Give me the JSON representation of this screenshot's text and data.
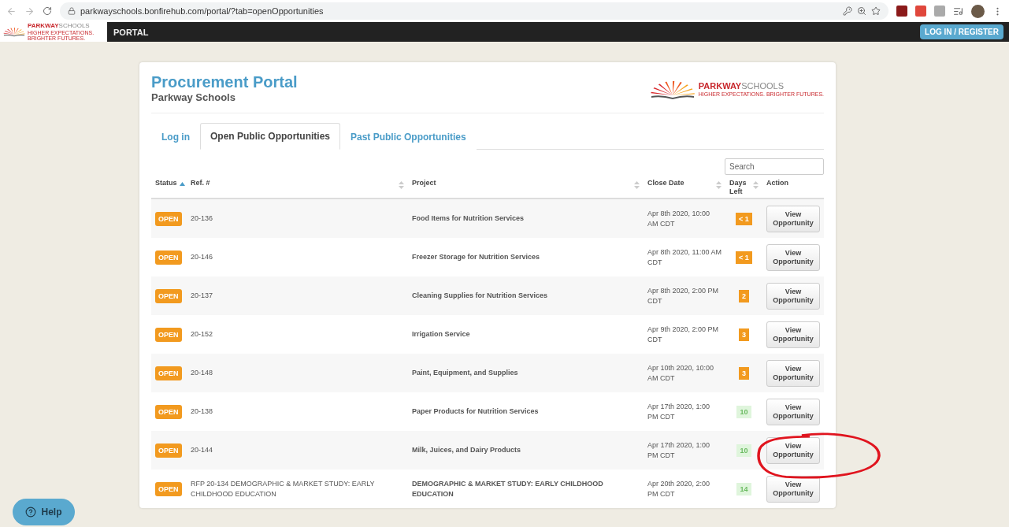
{
  "browser": {
    "url": "parkwayschools.bonfirehub.com/portal/?tab=openOpportunities"
  },
  "navbar": {
    "logo": {
      "brand_bold": "PARKWAY",
      "brand_light": "SCHOOLS",
      "tagline": "HIGHER EXPECTATIONS. BRIGHTER FUTURES."
    },
    "title": "PORTAL",
    "login_button": "LOG IN / REGISTER"
  },
  "header": {
    "title": "Procurement Portal",
    "subtitle": "Parkway Schools",
    "logo": {
      "brand_bold": "PARKWAY",
      "brand_light": "SCHOOLS",
      "tagline": "HIGHER EXPECTATIONS. BRIGHTER FUTURES."
    }
  },
  "tabs": [
    {
      "label": "Log in",
      "selected": false
    },
    {
      "label": "Open Public Opportunities",
      "selected": true
    },
    {
      "label": "Past Public Opportunities",
      "selected": false
    }
  ],
  "search": {
    "placeholder": "Search"
  },
  "table": {
    "columns": [
      {
        "label": "Status",
        "sortable": true,
        "sorted": true
      },
      {
        "label": "Ref. #",
        "sortable": true,
        "sorted": false
      },
      {
        "label": "Project",
        "sortable": true,
        "sorted": false
      },
      {
        "label": "Close Date",
        "sortable": true,
        "sorted": false
      },
      {
        "label": "Days Left",
        "sortable": true,
        "sorted": false
      },
      {
        "label": "Action",
        "sortable": false
      }
    ],
    "rows": [
      {
        "status": "OPEN",
        "ref": "20-136",
        "project": "Food Items for Nutrition Services",
        "close_date": "Apr 8th 2020, 10:00 AM CDT",
        "days_left": "< 1",
        "kind": "urgent",
        "action": "View Opportunity"
      },
      {
        "status": "OPEN",
        "ref": "20-146",
        "project": "Freezer Storage for Nutrition Services",
        "close_date": "Apr 8th 2020, 11:00 AM CDT",
        "days_left": "< 1",
        "kind": "urgent",
        "action": "View Opportunity"
      },
      {
        "status": "OPEN",
        "ref": "20-137",
        "project": "Cleaning Supplies for Nutrition Services",
        "close_date": "Apr 8th 2020, 2:00 PM CDT",
        "days_left": "2",
        "kind": "urgent",
        "action": "View Opportunity"
      },
      {
        "status": "OPEN",
        "ref": "20-152",
        "project": "Irrigation Service",
        "close_date": "Apr 9th 2020, 2:00 PM CDT",
        "days_left": "3",
        "kind": "urgent",
        "action": "View Opportunity"
      },
      {
        "status": "OPEN",
        "ref": "20-148",
        "project": "Paint, Equipment, and Supplies",
        "close_date": "Apr 10th 2020, 10:00 AM CDT",
        "days_left": "3",
        "kind": "urgent",
        "action": "View Opportunity"
      },
      {
        "status": "OPEN",
        "ref": "20-138",
        "project": "Paper Products for Nutrition Services",
        "close_date": "Apr 17th 2020, 1:00 PM CDT",
        "days_left": "10",
        "kind": "normal",
        "action": "View Opportunity"
      },
      {
        "status": "OPEN",
        "ref": "20-144",
        "project": "Milk, Juices, and Dairy Products",
        "close_date": "Apr 17th 2020, 1:00 PM CDT",
        "days_left": "10",
        "kind": "normal",
        "action": "View Opportunity"
      },
      {
        "status": "OPEN",
        "ref": "RFP 20-134 DEMOGRAPHIC & MARKET STUDY: EARLY CHILDHOOD EDUCATION",
        "project": "DEMOGRAPHIC & MARKET STUDY: EARLY CHILDHOOD EDUCATION",
        "close_date": "Apr 20th 2020, 2:00 PM CDT",
        "days_left": "14",
        "kind": "normal",
        "action": "View Opportunity"
      }
    ]
  },
  "help_button": "Help"
}
